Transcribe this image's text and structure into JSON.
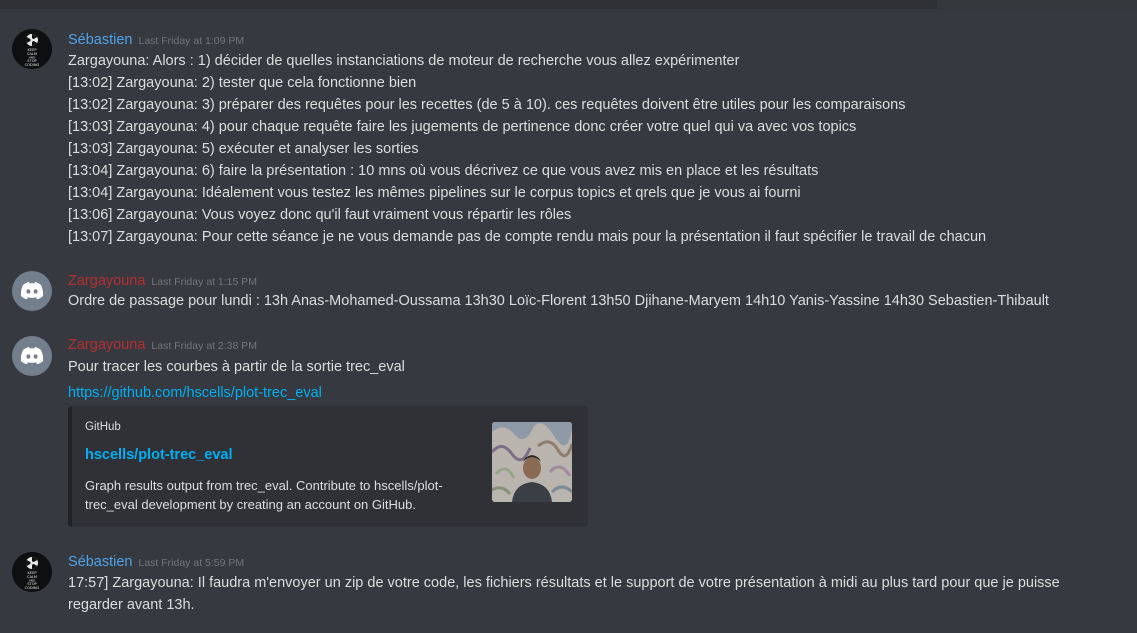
{
  "messages": [
    {
      "username": "Sébastien",
      "timestamp": "Last Friday at 1:09 PM",
      "lines": [
        "Zargayouna: Alors : 1) décider de quelles instanciations de moteur de recherche vous allez expérimenter",
        "[13:02] Zargayouna: 2) tester que cela fonctionne bien",
        "[13:02] Zargayouna: 3) préparer des requêtes pour les recettes (de 5 à 10). ces requêtes doivent être utiles pour les comparaisons",
        "[13:03] Zargayouna: 4) pour chaque requête faire les jugements de pertinence donc créer votre quel qui va avec vos topics",
        "[13:03] Zargayouna: 5) exécuter et analyser les sorties",
        "[13:04] Zargayouna: 6) faire la présentation : 10 mns où vous décrivez ce que vous avez mis en place et les résultats",
        "[13:04] Zargayouna: Idéalement vous testez les mêmes pipelines sur le corpus topics et qrels que je vous ai fourni",
        "[13:06] Zargayouna: Vous voyez donc qu'il faut vraiment vous répartir les rôles",
        "[13:07] Zargayouna: Pour cette séance je ne vous demande pas de compte rendu mais pour la présentation il faut spécifier le travail de chacun"
      ]
    },
    {
      "username": "Zargayouna",
      "timestamp": "Last Friday at 1:15 PM",
      "lines": [
        "Ordre de passage pour lundi : 13h Anas-Mohamed-Oussama 13h30 Loïc-Florent 13h50 Djihane-Maryem 14h10 Yanis-Yassine 14h30 Sebastien-Thibault"
      ]
    },
    {
      "username": "Zargayouna",
      "timestamp": "Last Friday at 2:38 PM",
      "lines": [
        "Pour tracer les courbes à partir de la sortie trec_eval"
      ],
      "link": "https://github.com/hscells/plot-trec_eval",
      "embed": {
        "provider": "GitHub",
        "title": "hscells/plot-trec_eval",
        "description": "Graph results output from trec_eval. Contribute to hscells/plot-trec_eval development by creating an account on GitHub."
      }
    },
    {
      "username": "Sébastien",
      "timestamp": "Last Friday at 5:59 PM",
      "lines": [
        "17:57] Zargayouna: Il faudra m'envoyer un zip de votre code, les fichiers résultats et le support de votre présentation à midi au plus tard pour que je puisse",
        "regarder avant 13h."
      ]
    }
  ],
  "avatar_seb_text": [
    "KEEP",
    "CALM",
    "AND",
    "STOP",
    "CODING"
  ],
  "colors": {
    "background": "#36393f",
    "username_sebastien": "#4fa3ea",
    "username_zargayouna": "#b53030",
    "link": "#00b0f4",
    "text": "#dcddde",
    "timestamp": "#72767d"
  },
  "icons": {
    "sebastien_avatar": "keep-calm-radiation-avatar",
    "zargayouna_avatar": "discord-logo-avatar"
  }
}
